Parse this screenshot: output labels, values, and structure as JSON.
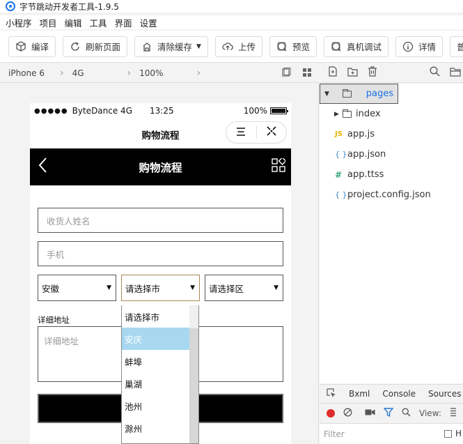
{
  "window": {
    "title": "字节跳动开发者工具-1.9.5"
  },
  "menu": [
    "小程序",
    "项目",
    "编辑",
    "工具",
    "界面",
    "设置"
  ],
  "toolbar": {
    "buttons": [
      {
        "label": "编译",
        "icon": "cube-icon"
      },
      {
        "label": "刷新页面",
        "icon": "refresh-icon"
      },
      {
        "label": "清除缓存",
        "icon": "clear-cache-icon"
      },
      {
        "label": "上传",
        "icon": "upload-icon"
      },
      {
        "label": "预览",
        "icon": "preview-icon"
      },
      {
        "label": "真机调试",
        "icon": "debug-icon"
      },
      {
        "label": "详情",
        "icon": "info-icon"
      },
      {
        "label": "普通",
        "icon": ""
      }
    ]
  },
  "device_bar": {
    "device": "iPhone 6",
    "network": "4G",
    "zoom": "100%"
  },
  "phone": {
    "status": {
      "carrier": "ByteDance 4G",
      "time": "13:25",
      "battery": "100%"
    },
    "nav_title": "购物流程",
    "header_title": "购物流程",
    "form": {
      "name_placeholder": "收货人姓名",
      "phone_placeholder": "手机",
      "province": "安徽",
      "city": "请选择市",
      "district": "请选择区",
      "address_label": "详细地址",
      "address_placeholder": "详细地址"
    },
    "city_options": [
      "请选择市",
      "安庆",
      "蚌埠",
      "巢湖",
      "池州",
      "滁州"
    ],
    "highlighted_option": "安庆"
  },
  "file_tree": {
    "root": "pages",
    "items": [
      {
        "label": "index",
        "type": "folder"
      },
      {
        "label": "app.js",
        "type": "js"
      },
      {
        "label": "app.json",
        "type": "json"
      },
      {
        "label": "app.ttss",
        "type": "ttss"
      },
      {
        "label": "project.config.json",
        "type": "json"
      }
    ]
  },
  "devtools": {
    "tabs": [
      "Bxml",
      "Console",
      "Sources"
    ],
    "view_label": "View:",
    "filter_placeholder": "Filter",
    "hide_label": "H"
  }
}
